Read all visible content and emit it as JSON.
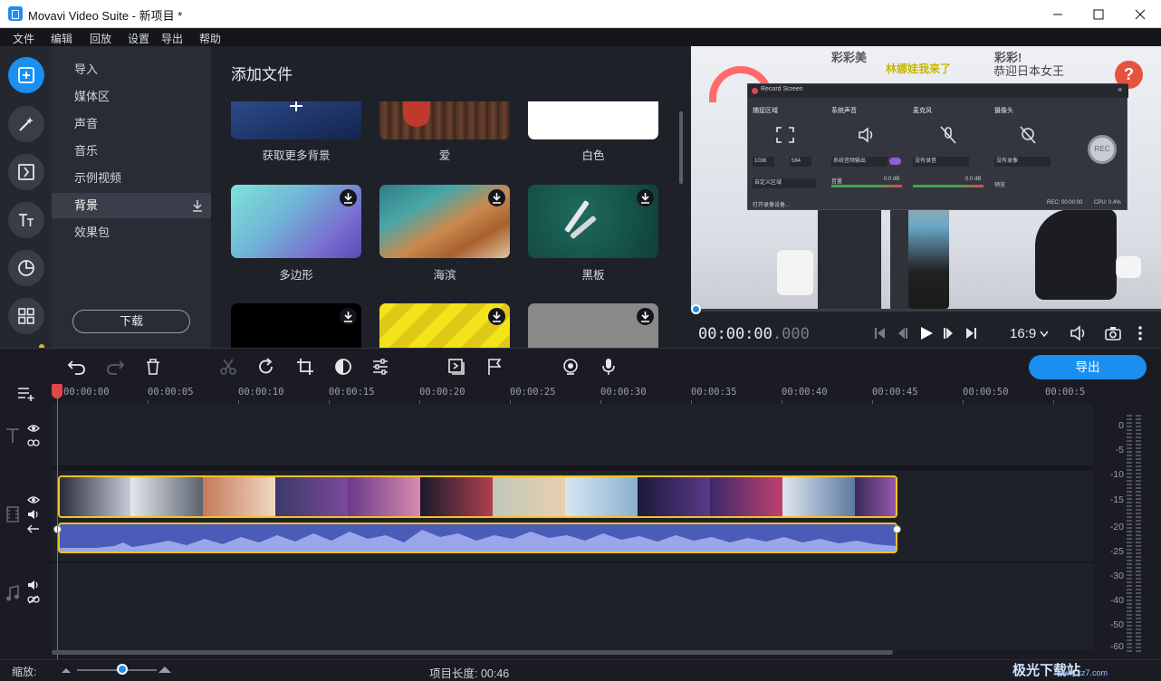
{
  "window": {
    "title": "Movavi Video Suite - 新项目 *"
  },
  "menu": [
    "文件",
    "编辑",
    "回放",
    "设置",
    "导出",
    "帮助"
  ],
  "rail": {
    "icons": [
      "add-files-icon",
      "magic-wand-icon",
      "transitions-icon",
      "titles-icon",
      "stickers-icon",
      "more-tools-icon"
    ]
  },
  "categories": {
    "items": [
      "导入",
      "媒体区",
      "声音",
      "音乐",
      "示例视频",
      "背景",
      "效果包"
    ],
    "active_index": 5,
    "download_button": "下载"
  },
  "library": {
    "title": "添加文件",
    "tiles": [
      {
        "label": "获取更多背景"
      },
      {
        "label": "爱"
      },
      {
        "label": "白色"
      },
      {
        "label": "多边形"
      },
      {
        "label": "海滨"
      },
      {
        "label": "黑板"
      },
      {
        "label": ""
      },
      {
        "label": ""
      },
      {
        "label": ""
      }
    ]
  },
  "preview": {
    "record_window_title": "Record Screen",
    "sections": [
      "捕捉区域",
      "系统声音",
      "麦克风",
      "摄像头"
    ],
    "width_value": "1036",
    "height_value": "584",
    "system_audio_device": "系统音频输出",
    "mic_device": "没有录音",
    "camera_device": "没有录像",
    "region_mode": "自定义区域",
    "volume_label": "音量",
    "db_left": "0.0 dB",
    "db_right": "0.0 dB",
    "preview_label": "预览",
    "rec_button": "REC",
    "open_settings": "打开录像设备...",
    "rec_time": "REC: 00:00:00",
    "cpu": "CPU:  0.4%",
    "caption_top": "彩彩美",
    "caption_line2": "林娜娃我来了",
    "caption_right": "彩彩!",
    "caption_right2": "恭迎日本女王",
    "help_icon": "?",
    "timecode_main": "00:00:00",
    "timecode_ms": ".000",
    "aspect_ratio": "16:9"
  },
  "toolbar": {
    "export_label": "导出"
  },
  "timeline": {
    "ruler": [
      "00:00:00",
      "00:00:05",
      "00:00:10",
      "00:00:15",
      "00:00:20",
      "00:00:25",
      "00:00:30",
      "00:00:35",
      "00:00:40",
      "00:00:45",
      "00:00:50",
      "00:00:5"
    ],
    "db_scale": [
      "0",
      "-5",
      "-10",
      "-15",
      "-20",
      "-25",
      "-30",
      "-40",
      "-50",
      "-60"
    ]
  },
  "status": {
    "zoom_label": "缩放:",
    "project_length": "项目长度:  00:46",
    "watermark": "极光下载站",
    "watermark_url": "www.xz7.com"
  }
}
